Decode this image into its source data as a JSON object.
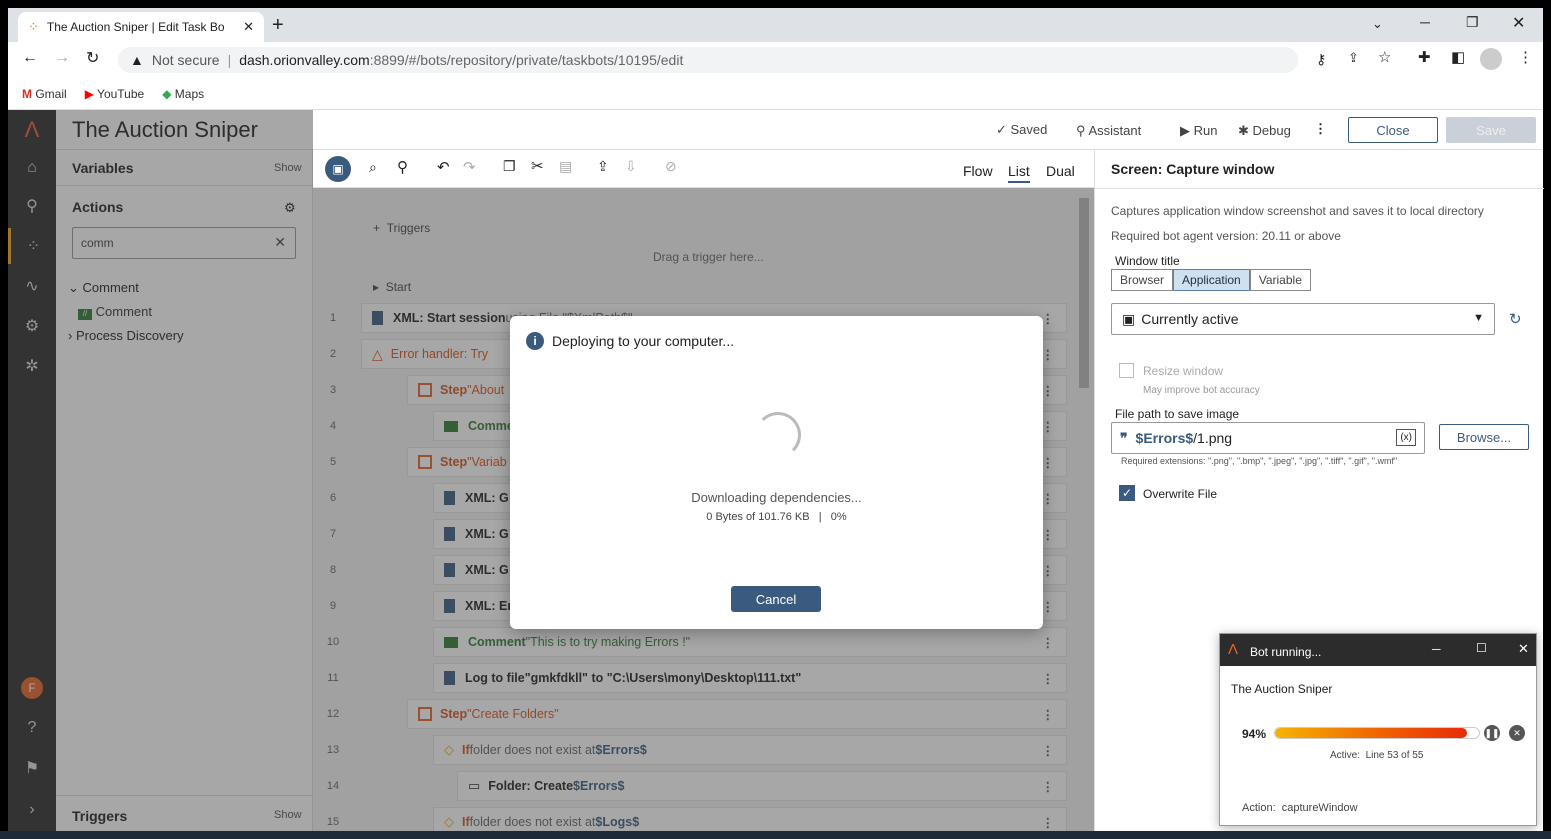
{
  "browser": {
    "tab_title": "The Auction Sniper | Edit Task Bo",
    "security": "Not secure",
    "url_host": "dash.orionvalley.com",
    "url_rest": ":8899/#/bots/repository/private/taskbots/10195/edit",
    "bookmarks": [
      "Gmail",
      "YouTube",
      "Maps"
    ]
  },
  "app": {
    "title": "The Auction Sniper",
    "saved": "Saved",
    "assistant": "Assistant",
    "run": "Run",
    "debug": "Debug",
    "close": "Close",
    "save": "Save",
    "avatar": "F"
  },
  "left": {
    "variables": "Variables",
    "show": "Show",
    "actions": "Actions",
    "search_value": "comm",
    "tree": [
      "Comment",
      "Comment",
      "Process Discovery"
    ],
    "triggers": "Triggers",
    "triggers_show": "Show"
  },
  "views": [
    "Flow",
    "List",
    "Dual"
  ],
  "canvas": {
    "triggers": "Triggers",
    "drag_trigger": "Drag a trigger here...",
    "start": "Start",
    "rows": [
      {
        "n": "1",
        "text": "XML: Start session",
        "rest": " using File \"$XmlPath$\""
      },
      {
        "n": "2",
        "text": "Error handler: Try",
        "rest": ""
      },
      {
        "n": "3",
        "text": "Step",
        "rest": " \"About"
      },
      {
        "n": "4",
        "text": "Comme",
        "rest": ""
      },
      {
        "n": "5",
        "text": "Step",
        "rest": " \"Variab"
      },
      {
        "n": "6",
        "text": "XML: G",
        "rest": ""
      },
      {
        "n": "7",
        "text": "XML: G",
        "rest": ""
      },
      {
        "n": "8",
        "text": "XML: G",
        "rest": ""
      },
      {
        "n": "9",
        "text": "XML: Er",
        "rest": ""
      },
      {
        "n": "10",
        "text": "Comment",
        "rest": " \"This is to try making Errors !\""
      },
      {
        "n": "11",
        "text": "Log to file",
        "rest": " \"gmkfdkll\" to \"C:\\Users\\mony\\Desktop\\111.txt\""
      },
      {
        "n": "12",
        "text": "Step",
        "rest": " \"Create Folders\""
      },
      {
        "n": "13",
        "text": "If",
        "rest": " folder does not exist at ",
        "var": "$Errors$"
      },
      {
        "n": "14",
        "text": "Folder: Create",
        "rest": " ",
        "var": "$Errors$"
      },
      {
        "n": "15",
        "text": "If",
        "rest": " folder does not exist at ",
        "var": "$Logs$"
      }
    ]
  },
  "right": {
    "title": "Screen: Capture window",
    "desc": "Captures application window screenshot and saves it to local directory",
    "version": "Required bot agent version: 20.11 or above",
    "window_title_label": "Window title",
    "seg": [
      "Browser",
      "Application",
      "Variable"
    ],
    "window_select": "Currently active",
    "resize": "Resize window",
    "resize_hint": "May improve bot accuracy",
    "file_label": "File path to save image",
    "file_var": "$Errors$",
    "file_rest": "/1.png",
    "var_btn": "(x)",
    "browse": "Browse...",
    "extensions": "Required extensions: \".png\", \".bmp\", \".jpeg\", \".jpg\", \".tiff\", \".gif\", \".wmf\"",
    "overwrite": "Overwrite File"
  },
  "modal": {
    "title": "Deploying to your computer...",
    "status": "Downloading dependencies...",
    "progress": "0 Bytes of 101.76 KB   |   0%",
    "cancel": "Cancel"
  },
  "botwin": {
    "title": "Bot running...",
    "name": "The Auction Sniper",
    "percent": "94%",
    "progress_fraction": 0.94,
    "active": "Active:  Line 53 of 55",
    "action": "Action:  captureWindow"
  }
}
